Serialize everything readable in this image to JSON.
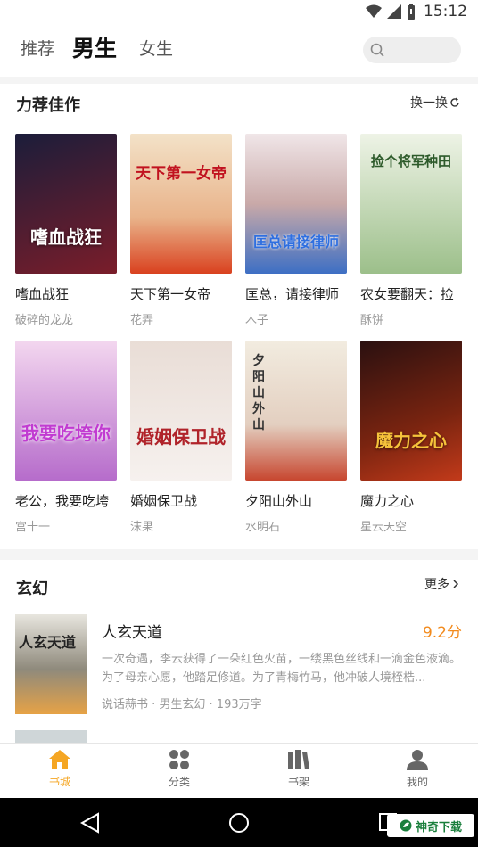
{
  "status": {
    "time": "15:12"
  },
  "header": {
    "tabs": [
      {
        "label": "推荐",
        "active": false
      },
      {
        "label": "男生",
        "active": true
      },
      {
        "label": "女生",
        "active": false
      }
    ],
    "search_icon": "search-icon"
  },
  "recommend": {
    "title": "力荐佳作",
    "action_label": "换一换",
    "books": [
      {
        "title": "嗜血战狂",
        "author": "破碎的龙龙",
        "cover_text": "嗜血战狂",
        "colors": [
          "#1b1d3a",
          "#7a1d2a"
        ]
      },
      {
        "title": "天下第一女帝",
        "author": "花弄",
        "cover_text": "天下第一女帝",
        "colors": [
          "#f3e2c8",
          "#d9411f"
        ]
      },
      {
        "title": "匡总，请接律师",
        "author": "木子",
        "cover_text": "匡总请接律师",
        "colors": [
          "#f0e6e8",
          "#3d6fc4"
        ]
      },
      {
        "title": "农女要翻天：捡",
        "author": "酥饼",
        "cover_text": "捡个将军种田",
        "colors": [
          "#e8efe0",
          "#9cbf8a"
        ]
      },
      {
        "title": "老公，我要吃垮",
        "author": "宫十一",
        "cover_text": "我要吃垮你",
        "colors": [
          "#f3d7ef",
          "#b66ccb"
        ]
      },
      {
        "title": "婚姻保卫战",
        "author": "沫果",
        "cover_text": "婚姻保卫战",
        "colors": [
          "#f6f1ee",
          "#d7c6bf"
        ]
      },
      {
        "title": "夕阳山外山",
        "author": "水明石",
        "cover_text": "夕阳山外山",
        "colors": [
          "#f2ece0",
          "#c7462f"
        ]
      },
      {
        "title": "魔力之心",
        "author": "星云天空",
        "cover_text": "魔力之心",
        "colors": [
          "#2a1010",
          "#c23a1a"
        ]
      }
    ]
  },
  "fantasy": {
    "title": "玄幻",
    "action_label": "更多",
    "items": [
      {
        "title": "人玄天道",
        "score": "9.2分",
        "desc": "一次奇遇，李云获得了一朵红色火苗，一缕黑色丝线和一滴金色液滴。为了母亲心愿，他踏足修道。为了青梅竹马，他冲破人境桎梏...",
        "meta": "说话蒜书 · 男生玄幻 · 193万字",
        "cover_text": "人玄天道"
      }
    ]
  },
  "bottom_nav": [
    {
      "label": "书城",
      "icon": "home-icon",
      "active": true
    },
    {
      "label": "分类",
      "icon": "category-icon",
      "active": false
    },
    {
      "label": "书架",
      "icon": "bookshelf-icon",
      "active": false
    },
    {
      "label": "我的",
      "icon": "profile-icon",
      "active": false
    }
  ],
  "watermark": "神奇下载"
}
